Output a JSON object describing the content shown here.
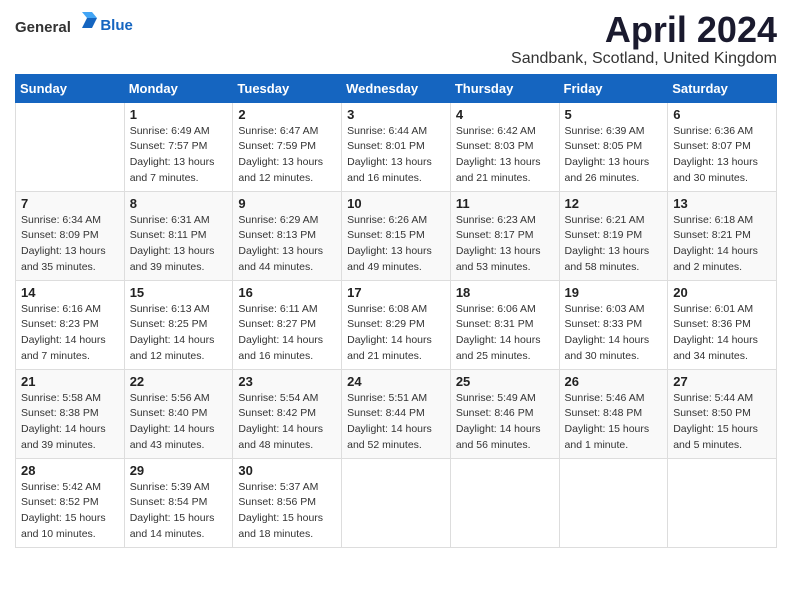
{
  "header": {
    "logo_general": "General",
    "logo_blue": "Blue",
    "month_title": "April 2024",
    "location": "Sandbank, Scotland, United Kingdom"
  },
  "weekdays": [
    "Sunday",
    "Monday",
    "Tuesday",
    "Wednesday",
    "Thursday",
    "Friday",
    "Saturday"
  ],
  "weeks": [
    [
      {
        "day": "",
        "sunrise": "",
        "sunset": "",
        "daylight": ""
      },
      {
        "day": "1",
        "sunrise": "Sunrise: 6:49 AM",
        "sunset": "Sunset: 7:57 PM",
        "daylight": "Daylight: 13 hours and 7 minutes."
      },
      {
        "day": "2",
        "sunrise": "Sunrise: 6:47 AM",
        "sunset": "Sunset: 7:59 PM",
        "daylight": "Daylight: 13 hours and 12 minutes."
      },
      {
        "day": "3",
        "sunrise": "Sunrise: 6:44 AM",
        "sunset": "Sunset: 8:01 PM",
        "daylight": "Daylight: 13 hours and 16 minutes."
      },
      {
        "day": "4",
        "sunrise": "Sunrise: 6:42 AM",
        "sunset": "Sunset: 8:03 PM",
        "daylight": "Daylight: 13 hours and 21 minutes."
      },
      {
        "day": "5",
        "sunrise": "Sunrise: 6:39 AM",
        "sunset": "Sunset: 8:05 PM",
        "daylight": "Daylight: 13 hours and 26 minutes."
      },
      {
        "day": "6",
        "sunrise": "Sunrise: 6:36 AM",
        "sunset": "Sunset: 8:07 PM",
        "daylight": "Daylight: 13 hours and 30 minutes."
      }
    ],
    [
      {
        "day": "7",
        "sunrise": "Sunrise: 6:34 AM",
        "sunset": "Sunset: 8:09 PM",
        "daylight": "Daylight: 13 hours and 35 minutes."
      },
      {
        "day": "8",
        "sunrise": "Sunrise: 6:31 AM",
        "sunset": "Sunset: 8:11 PM",
        "daylight": "Daylight: 13 hours and 39 minutes."
      },
      {
        "day": "9",
        "sunrise": "Sunrise: 6:29 AM",
        "sunset": "Sunset: 8:13 PM",
        "daylight": "Daylight: 13 hours and 44 minutes."
      },
      {
        "day": "10",
        "sunrise": "Sunrise: 6:26 AM",
        "sunset": "Sunset: 8:15 PM",
        "daylight": "Daylight: 13 hours and 49 minutes."
      },
      {
        "day": "11",
        "sunrise": "Sunrise: 6:23 AM",
        "sunset": "Sunset: 8:17 PM",
        "daylight": "Daylight: 13 hours and 53 minutes."
      },
      {
        "day": "12",
        "sunrise": "Sunrise: 6:21 AM",
        "sunset": "Sunset: 8:19 PM",
        "daylight": "Daylight: 13 hours and 58 minutes."
      },
      {
        "day": "13",
        "sunrise": "Sunrise: 6:18 AM",
        "sunset": "Sunset: 8:21 PM",
        "daylight": "Daylight: 14 hours and 2 minutes."
      }
    ],
    [
      {
        "day": "14",
        "sunrise": "Sunrise: 6:16 AM",
        "sunset": "Sunset: 8:23 PM",
        "daylight": "Daylight: 14 hours and 7 minutes."
      },
      {
        "day": "15",
        "sunrise": "Sunrise: 6:13 AM",
        "sunset": "Sunset: 8:25 PM",
        "daylight": "Daylight: 14 hours and 12 minutes."
      },
      {
        "day": "16",
        "sunrise": "Sunrise: 6:11 AM",
        "sunset": "Sunset: 8:27 PM",
        "daylight": "Daylight: 14 hours and 16 minutes."
      },
      {
        "day": "17",
        "sunrise": "Sunrise: 6:08 AM",
        "sunset": "Sunset: 8:29 PM",
        "daylight": "Daylight: 14 hours and 21 minutes."
      },
      {
        "day": "18",
        "sunrise": "Sunrise: 6:06 AM",
        "sunset": "Sunset: 8:31 PM",
        "daylight": "Daylight: 14 hours and 25 minutes."
      },
      {
        "day": "19",
        "sunrise": "Sunrise: 6:03 AM",
        "sunset": "Sunset: 8:33 PM",
        "daylight": "Daylight: 14 hours and 30 minutes."
      },
      {
        "day": "20",
        "sunrise": "Sunrise: 6:01 AM",
        "sunset": "Sunset: 8:36 PM",
        "daylight": "Daylight: 14 hours and 34 minutes."
      }
    ],
    [
      {
        "day": "21",
        "sunrise": "Sunrise: 5:58 AM",
        "sunset": "Sunset: 8:38 PM",
        "daylight": "Daylight: 14 hours and 39 minutes."
      },
      {
        "day": "22",
        "sunrise": "Sunrise: 5:56 AM",
        "sunset": "Sunset: 8:40 PM",
        "daylight": "Daylight: 14 hours and 43 minutes."
      },
      {
        "day": "23",
        "sunrise": "Sunrise: 5:54 AM",
        "sunset": "Sunset: 8:42 PM",
        "daylight": "Daylight: 14 hours and 48 minutes."
      },
      {
        "day": "24",
        "sunrise": "Sunrise: 5:51 AM",
        "sunset": "Sunset: 8:44 PM",
        "daylight": "Daylight: 14 hours and 52 minutes."
      },
      {
        "day": "25",
        "sunrise": "Sunrise: 5:49 AM",
        "sunset": "Sunset: 8:46 PM",
        "daylight": "Daylight: 14 hours and 56 minutes."
      },
      {
        "day": "26",
        "sunrise": "Sunrise: 5:46 AM",
        "sunset": "Sunset: 8:48 PM",
        "daylight": "Daylight: 15 hours and 1 minute."
      },
      {
        "day": "27",
        "sunrise": "Sunrise: 5:44 AM",
        "sunset": "Sunset: 8:50 PM",
        "daylight": "Daylight: 15 hours and 5 minutes."
      }
    ],
    [
      {
        "day": "28",
        "sunrise": "Sunrise: 5:42 AM",
        "sunset": "Sunset: 8:52 PM",
        "daylight": "Daylight: 15 hours and 10 minutes."
      },
      {
        "day": "29",
        "sunrise": "Sunrise: 5:39 AM",
        "sunset": "Sunset: 8:54 PM",
        "daylight": "Daylight: 15 hours and 14 minutes."
      },
      {
        "day": "30",
        "sunrise": "Sunrise: 5:37 AM",
        "sunset": "Sunset: 8:56 PM",
        "daylight": "Daylight: 15 hours and 18 minutes."
      },
      {
        "day": "",
        "sunrise": "",
        "sunset": "",
        "daylight": ""
      },
      {
        "day": "",
        "sunrise": "",
        "sunset": "",
        "daylight": ""
      },
      {
        "day": "",
        "sunrise": "",
        "sunset": "",
        "daylight": ""
      },
      {
        "day": "",
        "sunrise": "",
        "sunset": "",
        "daylight": ""
      }
    ]
  ]
}
